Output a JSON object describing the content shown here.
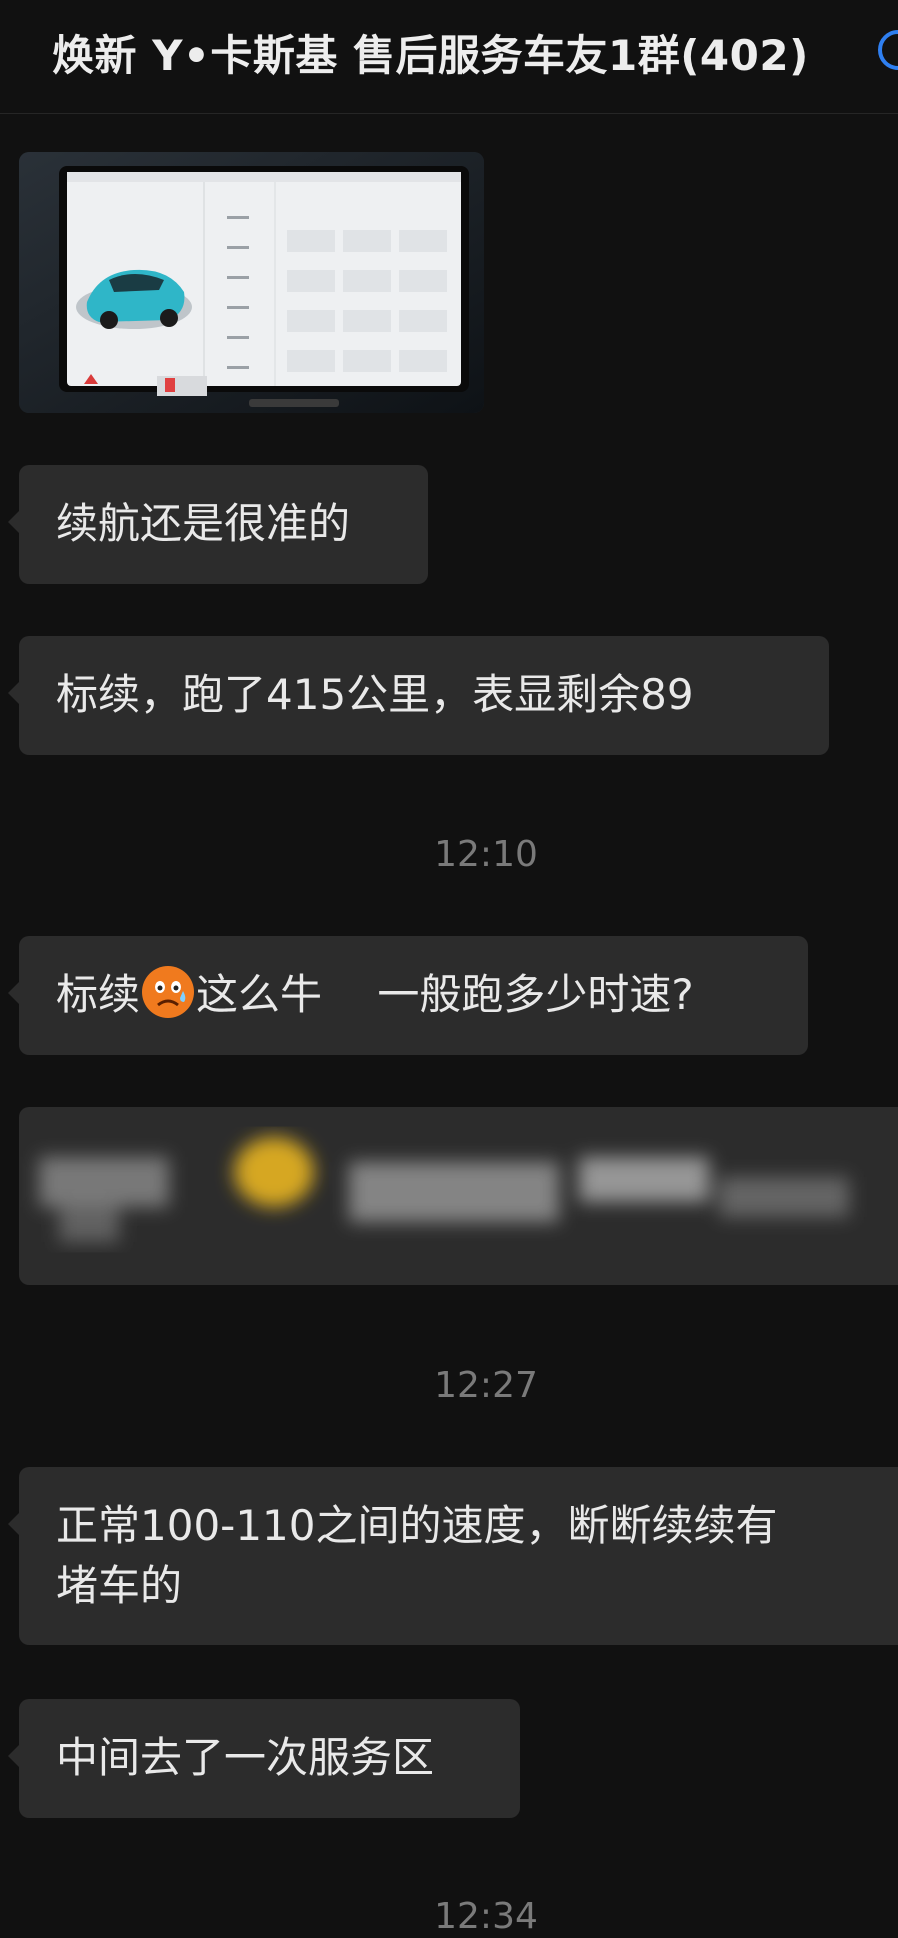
{
  "header": {
    "title": "焕新 Y•卡斯基 售后服务车友1群(402)",
    "icon": "chat-bubble-icon"
  },
  "messages": [
    {
      "kind": "image",
      "description": "photo of car infotainment screen"
    },
    {
      "kind": "text",
      "text": "续航还是很准的"
    },
    {
      "kind": "text",
      "text": "标续，跑了415公里，表显剩余89"
    },
    {
      "kind": "time",
      "text": "12:10"
    },
    {
      "kind": "text",
      "text_before": "标续",
      "emoji": "sweat-face-emoji",
      "text_after": "这么牛　 一般跑多少时速?"
    },
    {
      "kind": "blurred"
    },
    {
      "kind": "time",
      "text": "12:27"
    },
    {
      "kind": "text",
      "line1": "正常100-110之间的速度，断断续续有",
      "line2": "堵车的"
    },
    {
      "kind": "text",
      "text": "中间去了一次服务区"
    },
    {
      "kind": "time",
      "text": "12:34"
    }
  ],
  "colors": {
    "background": "#111111",
    "bubble": "#2c2c2c",
    "text": "#e9e9e9",
    "timestamp": "#7a7a7a",
    "accent": "#2f7ff0"
  }
}
